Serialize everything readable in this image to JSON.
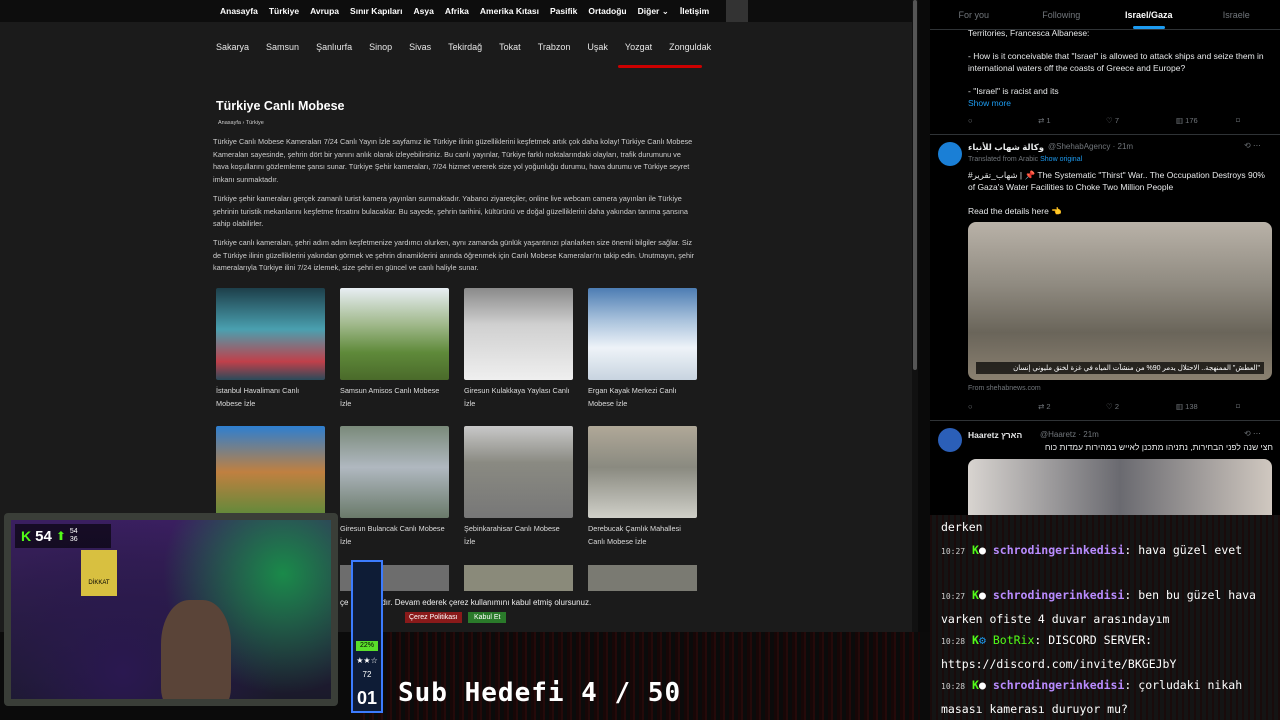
{
  "site": {
    "topnav": [
      "Anasayfa",
      "Türkiye",
      "Avrupa",
      "Sınır Kapıları",
      "Asya",
      "Afrika",
      "Amerika Kıtası",
      "Pasifik",
      "Ortadoğu",
      "Diğer ⌄",
      "İletişim"
    ],
    "cities": [
      "Sakarya",
      "Samsun",
      "Şanlıurfa",
      "Sinop",
      "Sivas",
      "Tekirdağ",
      "Tokat",
      "Trabzon",
      "Uşak",
      "Yozgat",
      "Zonguldak"
    ],
    "page_title": "Türkiye Canlı Mobese",
    "breadcrumb": "Anasayfa  ›  Türkiye",
    "paragraphs": [
      "Türkiye Canlı Mobese Kameraları 7/24 Canlı Yayın İzle sayfamız ile Türkiye ilinin güzelliklerini keşfetmek artık çok daha kolay! Türkiye Canlı Mobese Kameraları sayesinde, şehrin dört bir yanını anlık olarak izleyebilirsiniz. Bu canlı yayınlar, Türkiye farklı noktalarındaki olayları, trafik durumunu ve hava koşullarını gözlemleme şansı sunar. Türkiye Şehir kameraları, 7/24 hizmet vererek size yol yoğunluğu durumu, hava durumu ve Türkiye seyret imkanı sunmaktadır.",
      "Türkiye şehir kameraları gerçek zamanlı turist kamera yayınları sunmaktadır. Yabancı ziyaretçiler, online live webcam camera yayınları ile Türkiye şehrinin turistik mekanlarını keşfetme fırsatını bulacaklar. Bu sayede, şehrin tarihini, kültürünü ve doğal güzelliklerini daha yakından tanıma şansına sahip olabilirler.",
      "Türkiye canlı kameraları, şehri adım adım keşfetmenize yardımcı olurken, aynı zamanda günlük yaşantınızı planlarken size önemli bilgiler sağlar. Siz de Türkiye ilinin güzelliklerini yakından görmek ve şehrin dinamiklerini anında öğrenmek için Canlı Mobese Kameraları'nı takip edin. Unutmayın, şehir kameralarıyla Türkiye ilini 7/24 izlemek, size şehri en güncel ve canlı haliyle sunar."
    ],
    "cameras": [
      {
        "label": "İstanbul Havalimanı Canlı Mobese İzle",
        "color": "#3b7d8c"
      },
      {
        "label": "Samsun Amisos Canlı Mobese İzle",
        "color": "#6f8d4a"
      },
      {
        "label": "Giresun Kulakkaya Yaylası Canlı İzle",
        "color": "#b9b9b9"
      },
      {
        "label": "Ergan Kayak Merkezi Canlı Mobese İzle",
        "color": "#8aa7c8"
      },
      {
        "label": "",
        "color": "#c89048"
      },
      {
        "label": "Giresun Bulancak Canlı Mobese İzle",
        "color": "#8a8f8a"
      },
      {
        "label": "Şebinkarahisar Canlı Mobese İzle",
        "color": "#8a8a80"
      },
      {
        "label": "Derebucak Çamlık Mahallesi Canlı Mobese İzle",
        "color": "#9a9a90"
      }
    ],
    "cookie_text": "Sitemizde çerezler kullanılmaktadır. Devam ederek çerez kullanımını kabul etmiş olursunuz.",
    "cookie_visible": "çe                       unmaktadır. Devam ederek çerez kullanımını kabul etmiş olursunuz.",
    "cookie_policy": "Çerez Politikası",
    "cookie_accept": "Kabul Et"
  },
  "x": {
    "tabs": [
      "For you",
      "Following",
      "Israel/Gaza",
      "Israele"
    ],
    "active_tab": "Israel/Gaza",
    "post1": {
      "lines": [
        "Territories, Francesca Albanese:",
        "- How is it conceivable that \"Israel\" is allowed to attack ships and seize them in international waters off the coasts of Greece and Europe?",
        "- \"Israel\" is racist and its"
      ],
      "show_more": "Show more",
      "stats": [
        "1",
        "7",
        "176"
      ]
    },
    "post2": {
      "name": "وكالة شهاب للأنباء",
      "handle": "@ShehabAgency · 21m",
      "translated": "Translated from Arabic",
      "show_original": "Show original",
      "text": "#شهاب_تقرير | 📌 The Systematic \"Thirst\" War.. The Occupation Destroys 90% of Gaza's Water Facilities to Choke Two Million People",
      "details": "Read the details here 👈",
      "caption": "\"العطش\" الممنهجة.. الاحتلال يدمر 90% من منشآت المياه في غزة لخنق مليوني إنسان",
      "source": "From shehabnews.com",
      "stats": [
        "2",
        "2",
        "138"
      ]
    },
    "post3": {
      "name": "Haaretz הארץ",
      "handle": "@Haaretz · 21m",
      "text": "חצי שנה לפני הבחירות, נתניהו מתכנן לאייש במהירות עמדות כוח"
    }
  },
  "chat": [
    {
      "time": "",
      "user": "",
      "msg": "derken"
    },
    {
      "time": "10:27",
      "user": "schrodingerinkedisi",
      "msg": "hava güzel evet"
    },
    {
      "time": "10:27",
      "user": "schrodingerinkedisi",
      "msg": "ben bu güzel hava varken ofiste 4 duvar arasındayım"
    },
    {
      "time": "10:28",
      "user": "BotRix",
      "msg": "DISCORD SERVER: https://discord.com/invite/BKGEJbY"
    },
    {
      "time": "10:28",
      "user": "schrodingerinkedisi",
      "msg": "çorludaki nikah masası kamerası duruyor mu?"
    }
  ],
  "overlay": {
    "viewers": "54",
    "stat_a": "54",
    "stat_b": "36",
    "meter_pct": "22%",
    "meter_count": "72",
    "meter_level": "01",
    "sub_goal": "Sub Hedefi 4 / 50",
    "dikkat": "DİKKAT"
  }
}
